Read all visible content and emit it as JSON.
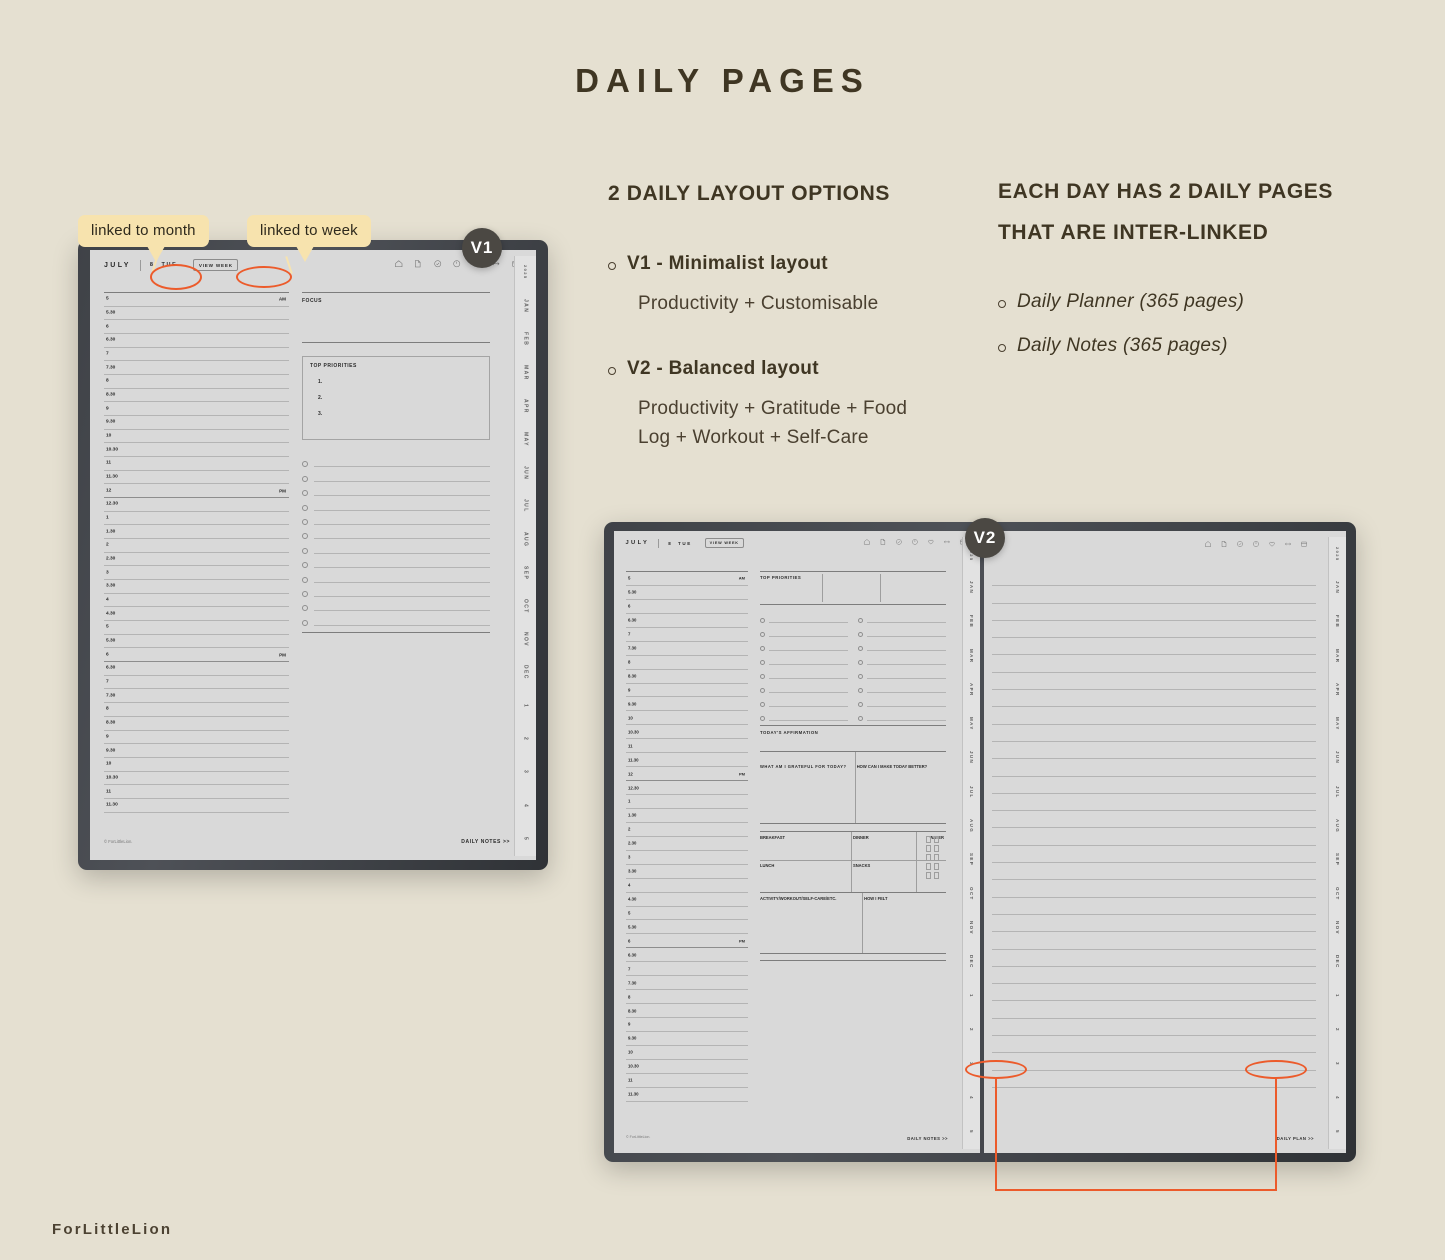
{
  "page": {
    "title": "DAILY PAGES",
    "brand": "ForLittleLion",
    "bg_color": "#e5e0d1",
    "accent_color": "#ec5b2b",
    "callout_color": "#f7e3ae",
    "text_color": "#3f3623"
  },
  "column_left": {
    "heading": "2 DAILY LAYOUT OPTIONS",
    "items": [
      {
        "title": "V1 - Minimalist layout",
        "desc_lines": [
          "Productivity + Customisable"
        ]
      },
      {
        "title": "V2 - Balanced layout",
        "desc_lines": [
          "Productivity + Gratitude + Food",
          "Log + Workout + Self-Care"
        ]
      }
    ]
  },
  "column_right": {
    "heading_line1": "EACH DAY HAS 2 DAILY PAGES",
    "heading_line2": "THAT ARE INTER-LINKED",
    "items": [
      "Daily Planner (365 pages)",
      "Daily Notes (365 pages)"
    ]
  },
  "callouts": [
    {
      "label": "linked to month"
    },
    {
      "label": "linked to week"
    }
  ],
  "badges": {
    "v1": "V1",
    "v2": "V2"
  },
  "planner_header": {
    "month": "JULY",
    "day_number": "8",
    "weekday": "TUE",
    "view_week_button": "VIEW WEEK",
    "icons": [
      "home-icon",
      "page-icon",
      "check-circle-icon",
      "clock-icon",
      "heart-icon",
      "arrows-icon",
      "calendar-icon"
    ]
  },
  "v1_page": {
    "am_label": "AM",
    "pm_label": "PM",
    "times": [
      "5",
      "5.30",
      "6",
      "6.30",
      "7",
      "7.30",
      "8",
      "8.30",
      "9",
      "9.30",
      "10",
      "10.30",
      "11",
      "11.30",
      "12",
      "12.30",
      "1",
      "1.30",
      "2",
      "2.30",
      "3",
      "3.30",
      "4",
      "4.30",
      "5",
      "5.30",
      "6",
      "6.30",
      "7",
      "7.30",
      "8",
      "8.30",
      "9",
      "9.30",
      "10",
      "10.30",
      "11",
      "11.30"
    ],
    "am_index": 0,
    "pm_index_noon": 14,
    "pm_index_evening": 26,
    "focus_label": "FOCUS",
    "top_priorities_label": "TOP PRIORITIES",
    "priority_items": [
      "1.",
      "2.",
      "3."
    ],
    "checkbox_count": 12,
    "footer_copyright": "© ForLittleLion.",
    "footer_link": "DAILY NOTES >>"
  },
  "v2_page": {
    "am_label": "AM",
    "pm_label": "PM",
    "times": [
      "5",
      "5.30",
      "6",
      "6.30",
      "7",
      "7.30",
      "8",
      "8.30",
      "9",
      "9.30",
      "10",
      "10.30",
      "11",
      "11.30",
      "12",
      "12.30",
      "1",
      "1.30",
      "2",
      "2.30",
      "3",
      "3.30",
      "4",
      "4.30",
      "5",
      "5.30",
      "6",
      "6.30",
      "7",
      "7.30",
      "8",
      "8.30",
      "9",
      "9.30",
      "10",
      "10.30",
      "11",
      "11.30"
    ],
    "top_priorities_label": "TOP PRIORITIES",
    "priority_columns": 3,
    "task_rows": 8,
    "task_columns": 2,
    "affirmation_label": "TODAY'S AFFIRMATION",
    "gratitude_label": "WHAT AM I GRATEFUL FOR TODAY?",
    "better_label": "HOW CAN I MAKE TODAY BETTER?",
    "meals": {
      "breakfast": "BREAKFAST",
      "dinner": "DINNER",
      "water": "WATER",
      "lunch": "LUNCH",
      "snacks": "SNACKS",
      "water_rows": 5,
      "water_cols": 2
    },
    "activity_label": "ACTIVITY/WORKOUT/SELF-CARE/ETC.",
    "felt_label": "HOW I FELT",
    "footer_copyright": "© ForLittleLion.",
    "footer_link": "DAILY NOTES >>"
  },
  "v2_notes_page": {
    "footer_link": "DAILY PLAN >>",
    "line_count": 30
  },
  "side_tabs": [
    "2025",
    "JAN",
    "FEB",
    "MAR",
    "APR",
    "MAY",
    "JUN",
    "JUL",
    "AUG",
    "SEP",
    "OCT",
    "NOV",
    "DEC",
    "1",
    "2",
    "3",
    "4",
    "5"
  ]
}
